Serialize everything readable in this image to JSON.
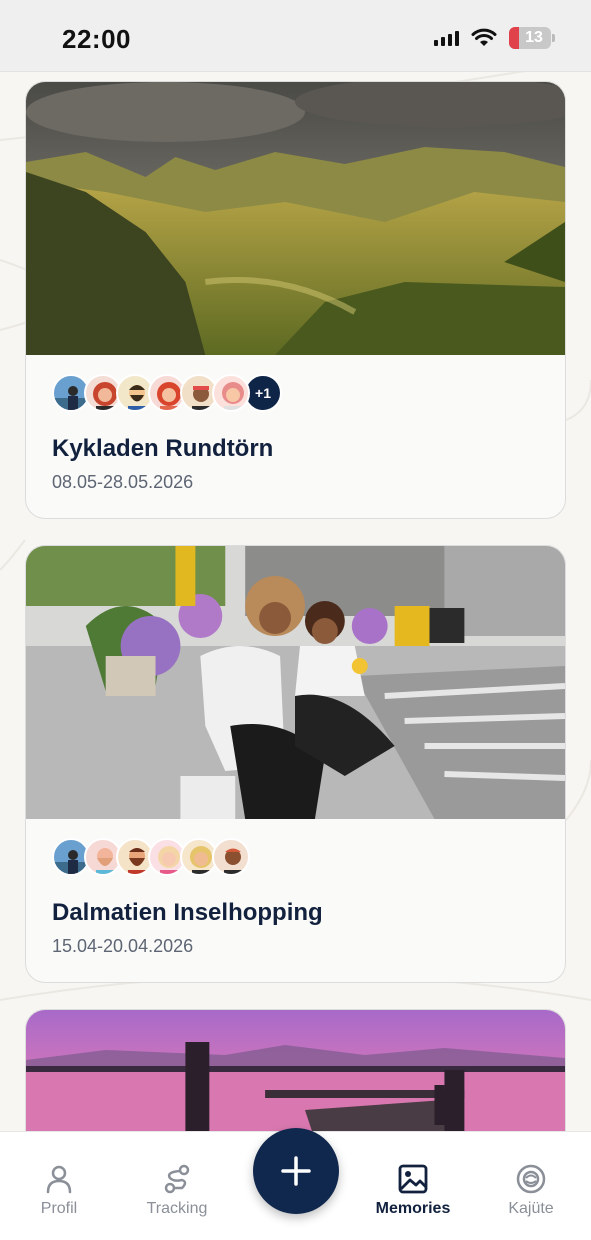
{
  "status_bar": {
    "time": "22:00",
    "battery": "13"
  },
  "memories": [
    {
      "title": "Kykladen Rundtörn",
      "dates": "08.05-28.05.2026",
      "image": "mountain-landscape",
      "avatars": [
        "avatar-man-photo",
        "avatar-red-hair-woman",
        "avatar-bearded-man",
        "avatar-red-hair-woman-2",
        "avatar-man-headband",
        "avatar-pink-hair-woman"
      ],
      "more_count": "+1"
    },
    {
      "title": "Dalmatien Inselhopping",
      "dates": "15.04-20.04.2026",
      "image": "mother-daughter-street",
      "avatars": [
        "avatar-man-photo",
        "avatar-bald-bearded-man",
        "avatar-bearded-man-2",
        "avatar-blonde-woman",
        "avatar-blonde-woman-2",
        "avatar-dark-skinned-man"
      ]
    },
    {
      "image": "sunset-pier"
    }
  ],
  "tabs": [
    {
      "label": "Profil",
      "icon": "person-icon",
      "active": false
    },
    {
      "label": "Tracking",
      "icon": "route-icon",
      "active": false
    },
    {
      "label": "Memories",
      "icon": "image-icon",
      "active": true
    },
    {
      "label": "Kajüte",
      "icon": "lifebuoy-icon",
      "active": false
    }
  ],
  "fab": {
    "icon": "plus-icon"
  },
  "colors": {
    "navy": "#10284d",
    "background": "#f7f6f3",
    "battery_low": "#e0414b"
  }
}
